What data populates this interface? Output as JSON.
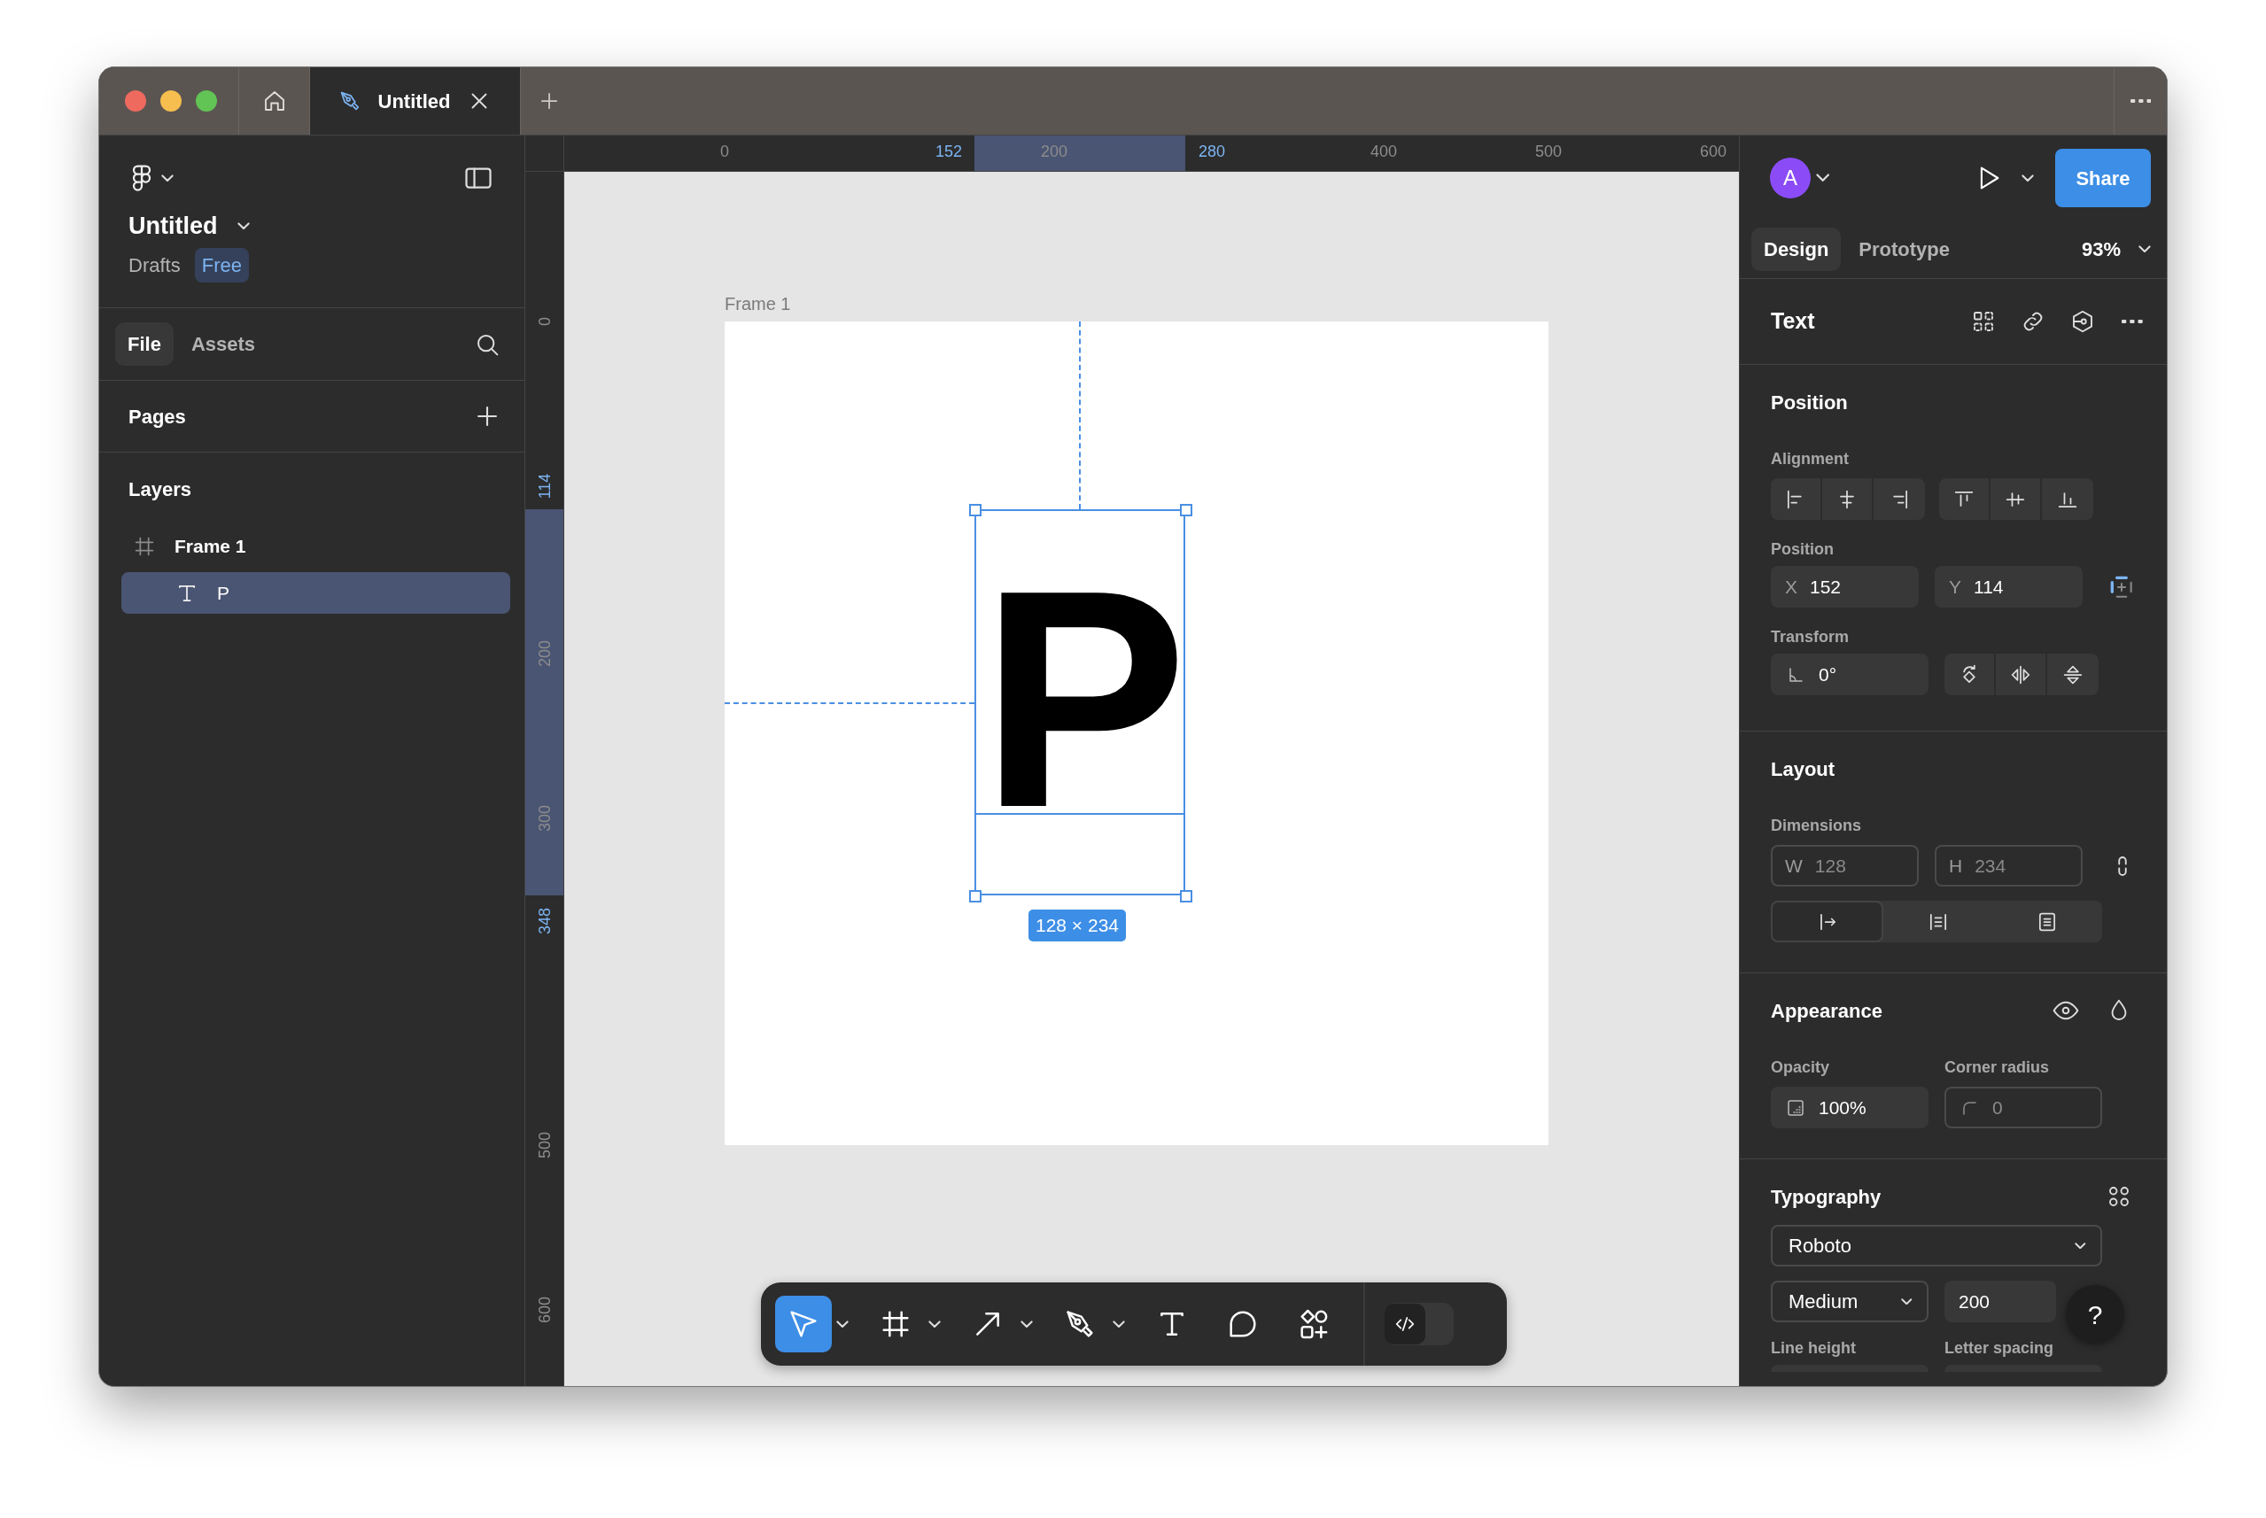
{
  "title_bar": {
    "tabs": [
      {
        "kind": "home",
        "selected": false
      },
      {
        "kind": "design-file",
        "label": "Untitled",
        "selected": true
      }
    ]
  },
  "left_panel": {
    "file_name": "Untitled",
    "location": "Drafts",
    "plan_badge": "Free",
    "tabs": [
      {
        "label": "File",
        "selected": true
      },
      {
        "label": "Assets",
        "selected": false
      }
    ],
    "pages_title": "Pages",
    "layers_title": "Layers",
    "layers": [
      {
        "kind": "frame",
        "name": "Frame 1",
        "selected": false,
        "children": [
          {
            "kind": "text",
            "name": "P",
            "selected": true
          }
        ]
      }
    ]
  },
  "rulers": {
    "horizontal": [
      {
        "label": "0",
        "highlighted": false
      },
      {
        "label": "152",
        "highlighted": true
      },
      {
        "label": "200",
        "highlighted": false
      },
      {
        "label": "280",
        "highlighted": true
      },
      {
        "label": "400",
        "highlighted": false
      },
      {
        "label": "500",
        "highlighted": false
      },
      {
        "label": "600",
        "highlighted": false
      }
    ],
    "vertical": [
      {
        "label": "0",
        "highlighted": false
      },
      {
        "label": "114",
        "highlighted": true
      },
      {
        "label": "200",
        "highlighted": false
      },
      {
        "label": "300",
        "highlighted": false
      },
      {
        "label": "348",
        "highlighted": true
      },
      {
        "label": "500",
        "highlighted": false
      },
      {
        "label": "600",
        "highlighted": false
      }
    ]
  },
  "canvas": {
    "frame_label": "Frame 1",
    "text_layer": "P",
    "size_badge": "128 × 234"
  },
  "toolbar": {
    "tools": [
      {
        "kind": "move",
        "selected": true,
        "has_menu": true
      },
      {
        "kind": "frame",
        "selected": false,
        "has_menu": true
      },
      {
        "kind": "line",
        "selected": false,
        "has_menu": true
      },
      {
        "kind": "pen",
        "selected": false,
        "has_menu": true
      },
      {
        "kind": "text",
        "selected": false,
        "has_menu": false
      },
      {
        "kind": "comment",
        "selected": false,
        "has_menu": false
      },
      {
        "kind": "actions",
        "selected": false,
        "has_menu": false
      }
    ],
    "dev_mode": {
      "on": false
    }
  },
  "right_panel": {
    "avatar_initial": "A",
    "share_label": "Share",
    "tabs": [
      {
        "label": "Design",
        "selected": true
      },
      {
        "label": "Prototype",
        "selected": false
      }
    ],
    "zoom": "93%",
    "selection_type": "Text",
    "position": {
      "title": "Position",
      "alignment_label": "Alignment",
      "position_label": "Position",
      "fields": [
        {
          "prefix": "X",
          "value": "152",
          "disabled": false
        },
        {
          "prefix": "Y",
          "value": "114",
          "disabled": false
        }
      ],
      "transform_label": "Transform",
      "rotation": "0°"
    },
    "layout": {
      "title": "Layout",
      "dimensions_label": "Dimensions",
      "fields": [
        {
          "prefix": "W",
          "value": "128",
          "disabled": true
        },
        {
          "prefix": "H",
          "value": "234",
          "disabled": true
        }
      ],
      "resizing": [
        {
          "kind": "auto-width",
          "selected": true
        },
        {
          "kind": "auto-height",
          "selected": false
        },
        {
          "kind": "fixed-size",
          "selected": false
        }
      ]
    },
    "appearance": {
      "title": "Appearance",
      "fields": [
        {
          "kind": "opacity",
          "label": "Opacity",
          "value": "100%",
          "disabled": false
        },
        {
          "kind": "corner-radius",
          "label": "Corner radius",
          "value": "0",
          "disabled": true
        }
      ]
    },
    "typography": {
      "title": "Typography",
      "font_family": "Roboto",
      "font_weight": "Medium",
      "font_size": "200",
      "labels": [
        "Line height",
        "Letter spacing"
      ]
    }
  },
  "help_label": "?"
}
